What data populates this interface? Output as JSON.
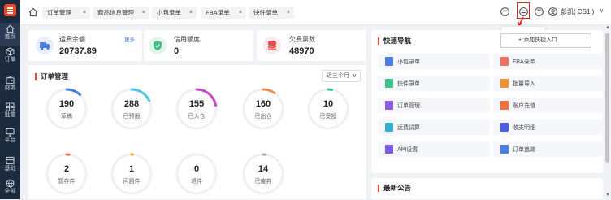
{
  "sidebar": {
    "items": [
      {
        "label": "首页",
        "icon": "home-icon"
      },
      {
        "label": "订单",
        "icon": "cube-icon"
      },
      {
        "label": "财务",
        "icon": "wallet-icon"
      },
      {
        "label": "批量",
        "icon": "grid-icon"
      },
      {
        "label": "平台",
        "icon": "monitor-icon"
      },
      {
        "label": "基础",
        "icon": "settings-icon"
      },
      {
        "label": "全部",
        "icon": "globe-icon"
      }
    ]
  },
  "tabs": [
    {
      "label": "订单管理"
    },
    {
      "label": "商品信息管理"
    },
    {
      "label": "小包录单"
    },
    {
      "label": "FBA录单"
    },
    {
      "label": "快件录单"
    }
  ],
  "tab_close": "×",
  "user": {
    "name": "彭凯( CS1 )",
    "arrow": "∨"
  },
  "tooltip": "切换表格版本",
  "stats": {
    "balance": {
      "label": "运费余额",
      "value": "20737.89",
      "more": "更多"
    },
    "credit": {
      "label": "信用额度",
      "value": "0"
    },
    "debt": {
      "label": "欠费票数",
      "value": "48970"
    }
  },
  "orders": {
    "title": "订单管理",
    "range": "近三个月",
    "range_arrow": "∨",
    "rings": [
      {
        "num": "190",
        "label": "草稿",
        "color": "#4a7de0",
        "fraction": 0.12
      },
      {
        "num": "288",
        "label": "已预报",
        "color": "#4ec8e0",
        "fraction": 0.18
      },
      {
        "num": "155",
        "label": "已入仓",
        "color": "#c44ac8",
        "fraction": 0.22
      },
      {
        "num": "160",
        "label": "已出仓",
        "color": "#f08a5a",
        "fraction": 0.1
      },
      {
        "num": "10",
        "label": "已妥投",
        "color": "#3ec0a0",
        "fraction": 0.03
      },
      {
        "num": "2",
        "label": "暂存件",
        "color": "#e07060",
        "fraction": 0.02
      },
      {
        "num": "1",
        "label": "问题件",
        "color": "#f0a040",
        "fraction": 0.01
      },
      {
        "num": "0",
        "label": "退件",
        "color": "#cccccc",
        "fraction": 0.0
      },
      {
        "num": "14",
        "label": "已废弃",
        "color": "#aaaaaa",
        "fraction": 0.02
      }
    ]
  },
  "quick": {
    "title": "快速导航",
    "add_label": "+ 添加快捷入口",
    "items": [
      {
        "label": "小包录单",
        "icon": "file-icon",
        "color": "#4a7de0"
      },
      {
        "label": "FBA录单",
        "icon": "file-icon",
        "color": "#f07060"
      },
      {
        "label": "快件录单",
        "icon": "file-icon",
        "color": "#3ec08a"
      },
      {
        "label": "批量导入",
        "icon": "import-icon",
        "color": "#f09030"
      },
      {
        "label": "订单管理",
        "icon": "list-icon",
        "color": "#8a5ae0"
      },
      {
        "label": "账户充值",
        "icon": "wallet-icon",
        "color": "#f07040"
      },
      {
        "label": "运费试算",
        "icon": "calculator-icon",
        "color": "#30b0d0"
      },
      {
        "label": "收支明细",
        "icon": "book-icon",
        "color": "#4a60e0"
      },
      {
        "label": "API设置",
        "icon": "api-icon",
        "color": "#7a5ae0"
      },
      {
        "label": "订单追踪",
        "icon": "track-icon",
        "color": "#4a7de0"
      }
    ]
  },
  "notice": {
    "title": "最新公告"
  }
}
